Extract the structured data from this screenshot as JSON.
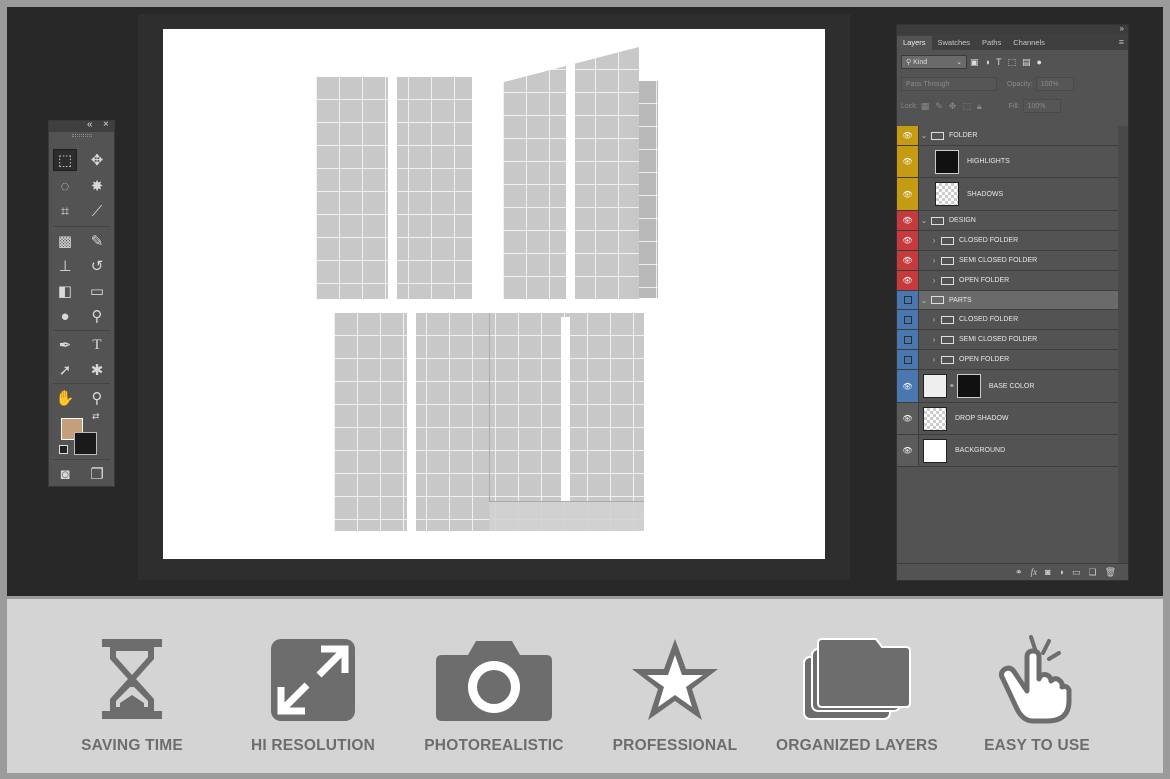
{
  "colors": {
    "accent_yellow": "#c59b13",
    "accent_red": "#c73a3c",
    "accent_blue": "#4b77b0",
    "foreground_swatch": "#c4a07a",
    "background_swatch": "#1a1a1a"
  },
  "tools": [
    "marquee-icon",
    "move-icon",
    "lasso-icon",
    "magic-wand-icon",
    "crop-icon",
    "eyedropper-icon",
    "spot-healing-icon",
    "brush-icon",
    "stamp-icon",
    "history-brush-icon",
    "eraser-icon",
    "gradient-icon",
    "blur-icon",
    "dodge-icon",
    "pen-icon",
    "type-icon",
    "path-select-icon",
    "shape-icon",
    "hand-icon",
    "zoom-icon"
  ],
  "layers_panel": {
    "tabs": [
      "Layers",
      "Swatches",
      "Paths",
      "Channels"
    ],
    "filter_kind": "Kind",
    "blend_mode": "Pass Through",
    "opacity_label": "Opacity:",
    "opacity_value": "100%",
    "lock_label": "Lock:",
    "fill_label": "Fill:",
    "fill_value": "100%",
    "layers": [
      {
        "name": "FOLDER",
        "type": "group-open"
      },
      {
        "name": "HIGHLIGHTS",
        "type": "layer"
      },
      {
        "name": "SHADOWS",
        "type": "layer"
      },
      {
        "name": "DESIGN",
        "type": "group-open"
      },
      {
        "name": "CLOSED FOLDER",
        "type": "group"
      },
      {
        "name": "SEMI CLOSED FOLDER",
        "type": "group"
      },
      {
        "name": "OPEN FOLDER",
        "type": "group"
      },
      {
        "name": "PARTS",
        "type": "group-open"
      },
      {
        "name": "CLOSED FOLDER",
        "type": "group"
      },
      {
        "name": "SEMI CLOSED FOLDER",
        "type": "group"
      },
      {
        "name": "OPEN FOLDER",
        "type": "group"
      },
      {
        "name": "BASE COLOR",
        "type": "layer"
      },
      {
        "name": "DROP SHADOW",
        "type": "layer"
      },
      {
        "name": "BACKGROUND",
        "type": "layer"
      }
    ]
  },
  "features": [
    {
      "label": "SAVING TIME",
      "icon": "hourglass-icon"
    },
    {
      "label": "HI RESOLUTION",
      "icon": "expand-icon"
    },
    {
      "label": "PHOTOREALISTIC",
      "icon": "camera-icon"
    },
    {
      "label": "PROFESSIONAL",
      "icon": "star-icon"
    },
    {
      "label": "ORGANIZED LAYERS",
      "icon": "layers-folder-icon"
    },
    {
      "label": "EASY TO USE",
      "icon": "tap-hand-icon"
    }
  ]
}
